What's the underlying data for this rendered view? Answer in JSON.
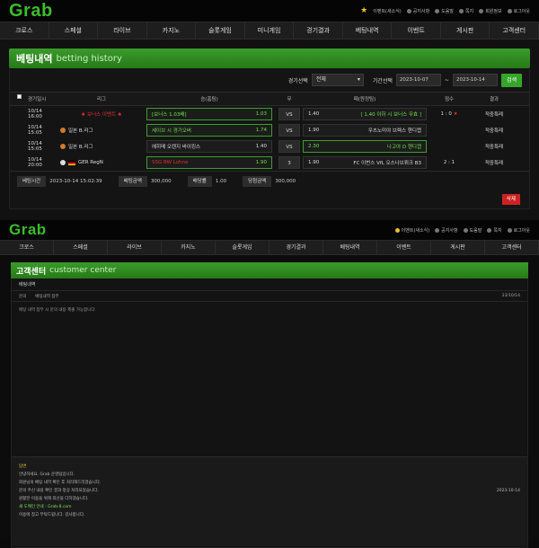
{
  "brand": "Grab",
  "top_links": [
    "이벤트(새소식)",
    "공지사항",
    "도움말",
    "쪽지",
    "회원정보",
    "로그아웃"
  ],
  "nav": [
    "크로스",
    "스페셜",
    "라이브",
    "카지노",
    "슬롯게임",
    "미니게임",
    "경기결과",
    "베팅내역",
    "이벤트",
    "게시판",
    "고객센터"
  ],
  "betting": {
    "title_ko": "베팅내역",
    "title_en": "betting history",
    "filter": {
      "game_label": "경기선택",
      "game_value": "전체",
      "period_label": "기간선택",
      "date_from": "2023-10-07",
      "date_to": "2023-10-14",
      "search_button": "검색"
    },
    "columns": [
      "경기일시",
      "리그",
      "승(홈팀)",
      "무",
      "패(원정팀)",
      "점수",
      "결과"
    ],
    "rows": [
      {
        "time": "10/14 16:00",
        "league": "♠ 보너스 이벤트 ♠",
        "home": "[보너스 1.03배]",
        "home_odd": "1.03",
        "draw": "VS",
        "away_odd": "1.40",
        "away": "[ 1.40 이하 시 보너스 무효 ]",
        "score": "1 : 0",
        "result": "적중특례"
      },
      {
        "time": "10/14 15:05",
        "league": "일본 B.리그",
        "home": "세이브 시 경기오버",
        "home_odd": "1.74",
        "draw": "VS",
        "away_odd": "1.90",
        "away": "우츠노미야 브렉스 핸디캡",
        "score": "",
        "result": "적중특례"
      },
      {
        "time": "10/14 15:05",
        "league": "일본 B.리그",
        "home": "에히메 오렌지 바이킹스",
        "home_odd": "1.40",
        "draw": "VS",
        "away_odd": "2.30",
        "away": "나고야 D 핸디캡",
        "score": "",
        "result": "적중특례"
      },
      {
        "time": "10/14 20:00",
        "league": "GER RegN",
        "home": "SSG BW Lohne",
        "home_odd": "1.90",
        "draw": "3",
        "away_odd": "1.90",
        "away": "FC 이번스 VfL 오스나브뤼크 B3",
        "score": "2 : 1",
        "result": "적중특례"
      }
    ],
    "summary": {
      "bet_time_label": "베팅시간",
      "bet_time": "2023-10-14 15:02:39",
      "bet_amount_label": "베팅금액",
      "bet_amount": "300,000",
      "odds_label": "배당률",
      "odds": "1.00",
      "win_label": "당첨금액",
      "win_amount": "300,000"
    },
    "delete_button": "삭제"
  },
  "support": {
    "title_ko": "고객센터",
    "title_en": "customer center",
    "sub": "베팅내역",
    "row_label": "문의",
    "row_text": "베팅내역 첨부",
    "row_date": "23/10/14",
    "note": "베팅 내역 첨부 시 문의 내용 제출 가능합니다.",
    "reply_title": "답변",
    "reply_line1": "안녕하세요. Grab 운영팀입니다.",
    "reply_line2": "회원님의 베팅 내역 확인 후 처리해드리겠습니다.",
    "reply_line3": "문의 주신 내용 확인 결과 정상 처리되었습니다.",
    "reply_date": "2023-10-14",
    "reply_line4": "원활한 이용을 위해 최선을 다하겠습니다.",
    "reply_line5": "새 도메인 안내 : Grab-8.com",
    "reply_line6": "이용에 참고 부탁드립니다. 감사합니다."
  }
}
